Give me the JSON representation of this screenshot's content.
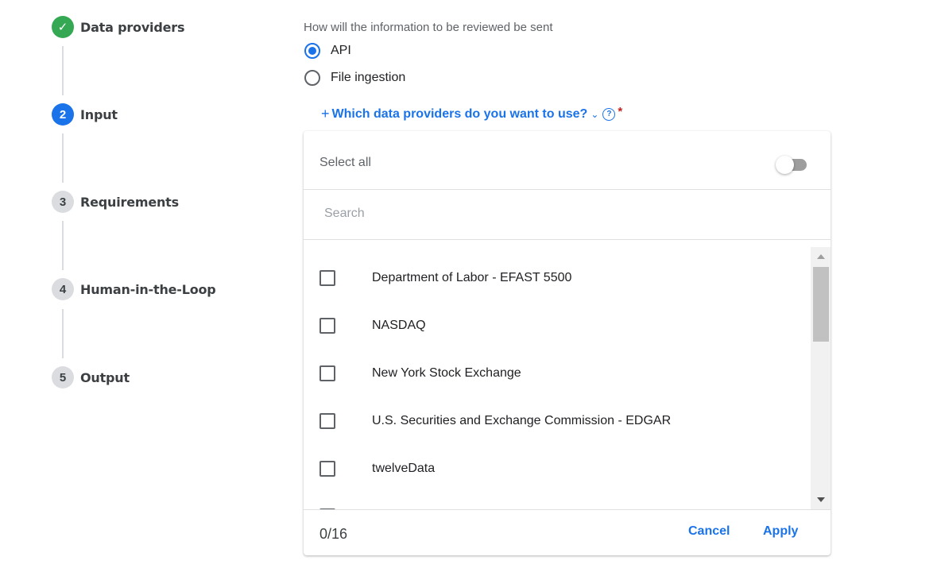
{
  "stepper": {
    "steps": [
      {
        "number": "",
        "label": "Data providers",
        "status": "done"
      },
      {
        "number": "2",
        "label": "Input",
        "status": "active"
      },
      {
        "number": "3",
        "label": "Requirements",
        "status": "pending"
      },
      {
        "number": "4",
        "label": "Human-in-the-Loop",
        "status": "pending"
      },
      {
        "number": "5",
        "label": "Output",
        "status": "pending"
      }
    ],
    "done_icon": "✓"
  },
  "form": {
    "question": "How will the information to be reviewed be sent",
    "options": [
      {
        "label": "API",
        "selected": true
      },
      {
        "label": "File ingestion",
        "selected": false
      }
    ],
    "providers_prompt": "Which data providers do you want to use?",
    "plus_icon": "+",
    "chevron_icon": "⌄",
    "help_icon": "?",
    "required_mark": "*"
  },
  "dropdown": {
    "select_all_label": "Select all",
    "select_all_enabled": false,
    "search_placeholder": "Search",
    "search_value": "",
    "items": [
      "Department of Labor - EFAST 5500",
      "NASDAQ",
      "New York Stock Exchange",
      "U.S. Securities and Exchange Commission - EDGAR",
      "twelveData"
    ],
    "selected_count": "0/16",
    "cancel_label": "Cancel",
    "apply_label": "Apply"
  },
  "colors": {
    "accent": "#1a73e8",
    "success": "#34a853",
    "required": "#c5221f"
  }
}
